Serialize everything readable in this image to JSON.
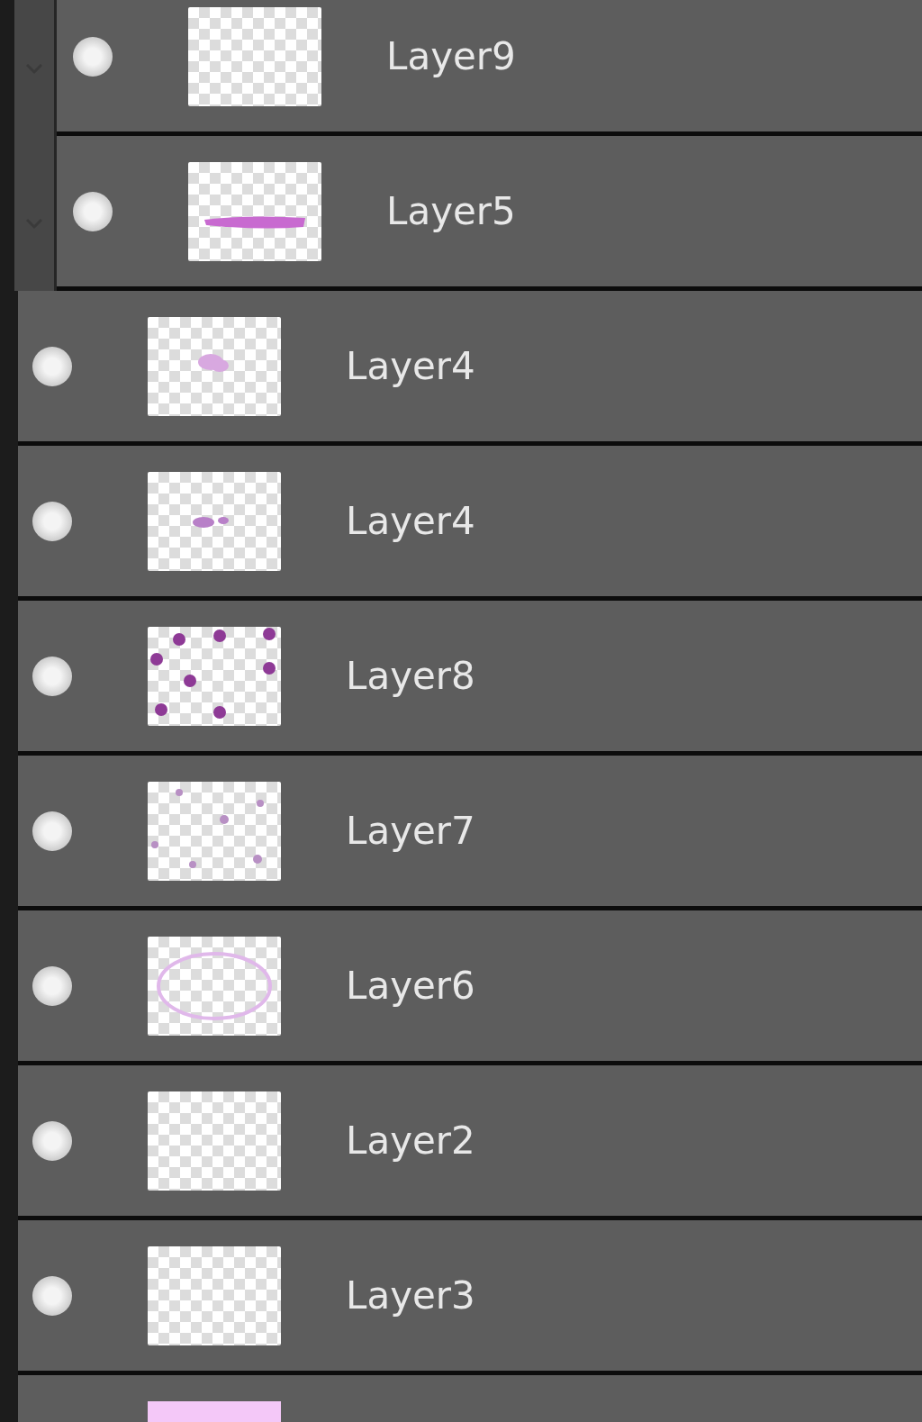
{
  "group_layers": [
    {
      "name": "Layer9",
      "visible": true,
      "kind": "empty"
    },
    {
      "name": "Layer5",
      "visible": true,
      "kind": "stroke"
    }
  ],
  "layers": [
    {
      "name": "Layer4",
      "visible": true,
      "kind": "blob"
    },
    {
      "name": "Layer4",
      "visible": true,
      "kind": "scribble"
    },
    {
      "name": "Layer8",
      "visible": true,
      "kind": "dots"
    },
    {
      "name": "Layer7",
      "visible": true,
      "kind": "scatter"
    },
    {
      "name": "Layer6",
      "visible": true,
      "kind": "ring"
    },
    {
      "name": "Layer2",
      "visible": true,
      "kind": "empty"
    },
    {
      "name": "Layer3",
      "visible": true,
      "kind": "empty"
    },
    {
      "kind": "fill"
    }
  ]
}
